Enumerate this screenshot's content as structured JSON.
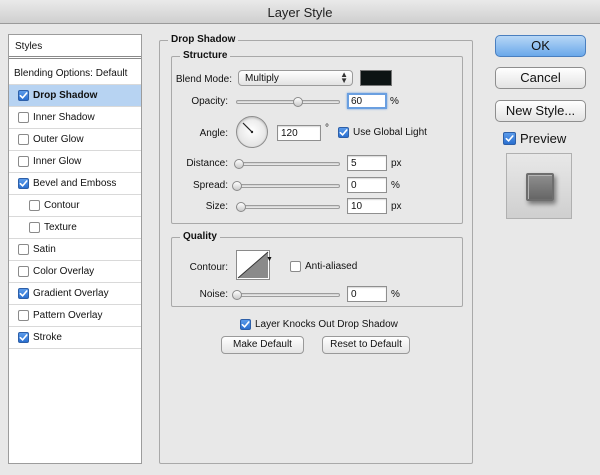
{
  "window": {
    "title": "Layer Style"
  },
  "styles_list": {
    "header": "Styles",
    "blending_options": "Blending Options: Default",
    "items": [
      {
        "label": "Drop Shadow",
        "checked": true,
        "selected": true,
        "sub": false
      },
      {
        "label": "Inner Shadow",
        "checked": false,
        "selected": false,
        "sub": false
      },
      {
        "label": "Outer Glow",
        "checked": false,
        "selected": false,
        "sub": false
      },
      {
        "label": "Inner Glow",
        "checked": false,
        "selected": false,
        "sub": false
      },
      {
        "label": "Bevel and Emboss",
        "checked": true,
        "selected": false,
        "sub": false
      },
      {
        "label": "Contour",
        "checked": false,
        "selected": false,
        "sub": true
      },
      {
        "label": "Texture",
        "checked": false,
        "selected": false,
        "sub": true
      },
      {
        "label": "Satin",
        "checked": false,
        "selected": false,
        "sub": false
      },
      {
        "label": "Color Overlay",
        "checked": false,
        "selected": false,
        "sub": false
      },
      {
        "label": "Gradient Overlay",
        "checked": true,
        "selected": false,
        "sub": false
      },
      {
        "label": "Pattern Overlay",
        "checked": false,
        "selected": false,
        "sub": false
      },
      {
        "label": "Stroke",
        "checked": true,
        "selected": false,
        "sub": false
      }
    ]
  },
  "drop_shadow": {
    "title": "Drop Shadow",
    "structure": {
      "title": "Structure",
      "blend_mode_label": "Blend Mode:",
      "blend_mode_value": "Multiply",
      "shadow_color": "#0d1414",
      "opacity_label": "Opacity:",
      "opacity_value": "60",
      "opacity_unit": "%",
      "opacity_fraction": 0.6,
      "angle_label": "Angle:",
      "angle_value": "120",
      "angle_unit": "°",
      "use_global_light_label": "Use Global Light",
      "use_global_light_checked": true,
      "distance_label": "Distance:",
      "distance_value": "5",
      "distance_unit": "px",
      "distance_fraction": 0.02,
      "spread_label": "Spread:",
      "spread_value": "0",
      "spread_unit": "%",
      "spread_fraction": 0.0,
      "size_label": "Size:",
      "size_value": "10",
      "size_unit": "px",
      "size_fraction": 0.04
    },
    "quality": {
      "title": "Quality",
      "contour_label": "Contour:",
      "anti_aliased_label": "Anti-aliased",
      "anti_aliased_checked": false,
      "noise_label": "Noise:",
      "noise_value": "0",
      "noise_unit": "%",
      "noise_fraction": 0.0
    },
    "knocks_out_label": "Layer Knocks Out Drop Shadow",
    "knocks_out_checked": true,
    "make_default_label": "Make Default",
    "reset_default_label": "Reset to Default"
  },
  "actions": {
    "ok_label": "OK",
    "cancel_label": "Cancel",
    "new_style_label": "New Style...",
    "preview_label": "Preview",
    "preview_checked": true
  }
}
